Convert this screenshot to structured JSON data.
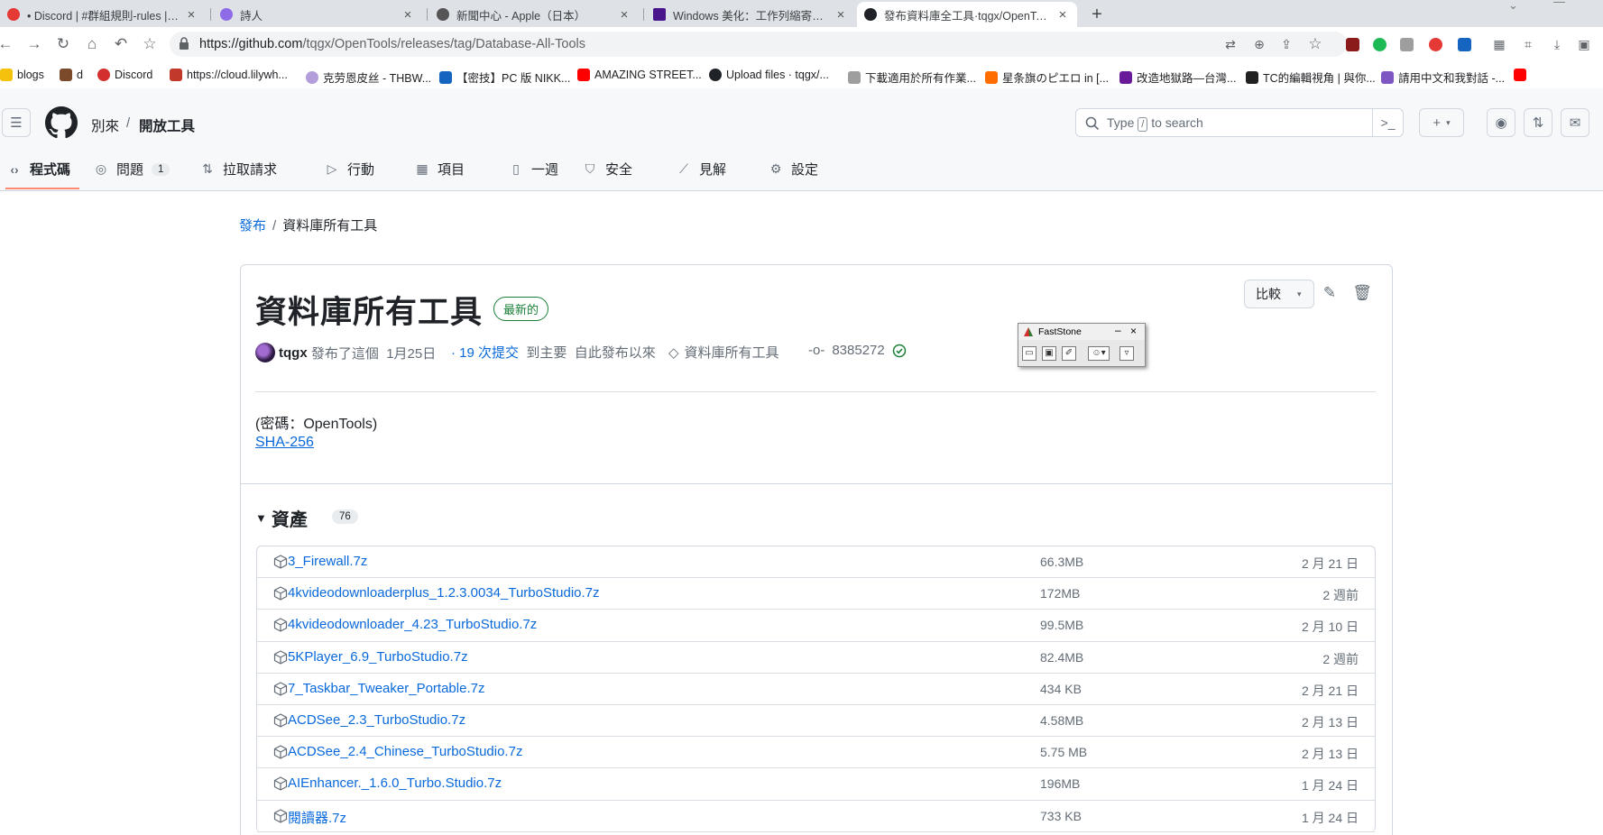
{
  "browser": {
    "tabs": [
      {
        "title": "• Discord | #群組規則-rules | 虛擬...",
        "icon_color": "#e53935",
        "active": false
      },
      {
        "title": "詩人",
        "icon_color": "#8e6ce8",
        "active": false
      },
      {
        "title": "新聞中心 - Apple（日本）",
        "icon_color": "#555555",
        "active": false
      },
      {
        "title": "Windows 美化：工作列縮寄、視...",
        "icon_color": "#4a148c",
        "active": false
      },
      {
        "title": "發布資料庫全工具·tqgx/OpenTools",
        "icon_color": "#1f2328",
        "active": true
      }
    ],
    "new_tab": "+",
    "url_host": "https://github.com",
    "url_path": "/tqgx/OpenTools/releases/tag/Database-All-Tools",
    "bookmarks": [
      {
        "label": "blogs",
        "icon_color": "#f4c20d"
      },
      {
        "label": "d",
        "icon_color": "#7b4a2a"
      },
      {
        "label": "Discord",
        "icon_color": "#d32f2f"
      },
      {
        "label": "https://cloud.lilywh...",
        "icon_color": "#c0392b"
      },
      {
        "label": "克劳恩皮丝 - THBW...",
        "icon_color": "#b39ddb"
      },
      {
        "label": "【密技】PC 版 NIKK...",
        "icon_color": "#1565c0"
      },
      {
        "label": "AMAZING STREET...",
        "icon_color": "#ff0000"
      },
      {
        "label": "Upload files · tqgx/...",
        "icon_color": "#1f2328"
      },
      {
        "label": "下載適用於所有作業...",
        "icon_color": "#9e9e9e"
      },
      {
        "label": "星条旗のピエロ in [...",
        "icon_color": "#ff6d00"
      },
      {
        "label": "改造地獄路—台灣...",
        "icon_color": "#6a1b9a"
      },
      {
        "label": "TC的編輯視角 | 與你...",
        "icon_color": "#212121"
      },
      {
        "label": "請用中文和我對話 -...",
        "icon_color": "#7e57c2"
      },
      {
        "label": "",
        "icon_color": "#ff0000"
      }
    ]
  },
  "github": {
    "owner": "別來",
    "repo": "開放工具",
    "search_prefix": "Type",
    "search_key": "/",
    "search_suffix": "to search",
    "nav": [
      {
        "label": "程式碼",
        "icon": "code-icon",
        "glyph": "‹›"
      },
      {
        "label": "問題",
        "icon": "issue-icon",
        "glyph": "◎",
        "count": "1"
      },
      {
        "label": "拉取請求",
        "icon": "pull-request-icon",
        "glyph": "⇅"
      },
      {
        "label": "行動",
        "icon": "actions-icon",
        "glyph": "▷"
      },
      {
        "label": "項目",
        "icon": "projects-icon",
        "glyph": "▦"
      },
      {
        "label": "一週",
        "icon": "wiki-icon",
        "glyph": "📖"
      },
      {
        "label": "安全",
        "icon": "shield-icon",
        "glyph": "⛉"
      },
      {
        "label": "見解",
        "icon": "graph-icon",
        "glyph": "⟋"
      },
      {
        "label": "設定",
        "icon": "gear-icon",
        "glyph": "⚙"
      }
    ]
  },
  "release": {
    "breadcrumb_link": "發布",
    "breadcrumb_current": "資料庫所有工具",
    "title": "資料庫所有工具",
    "badge": "最新的",
    "compare_label": "比較",
    "author": "tqgx",
    "published_text": "發布了這個",
    "date": "1月25日",
    "commits_link": "· 19 次提交",
    "commits_to": "到主要",
    "since_text": "自此發布以來",
    "tag": "資料庫所有工具",
    "commit": "8385272",
    "password_line": "(密碼：OpenTools)",
    "sha_link": "SHA-256"
  },
  "assets": {
    "heading": "資產",
    "count": "76",
    "items": [
      {
        "name": "3_Firewall.7z",
        "size": "66.3MB",
        "date": "2 月 21 日"
      },
      {
        "name": "4kvideodownloaderplus_1.2.3.0034_TurboStudio.7z",
        "size": "172MB",
        "date": "2 週前"
      },
      {
        "name": "4kvideodownloader_4.23_TurboStudio.7z",
        "size": "99.5MB",
        "date": "2 月 10 日"
      },
      {
        "name": "5KPlayer_6.9_TurboStudio.7z",
        "size": "82.4MB",
        "date": "2 週前"
      },
      {
        "name": "7_Taskbar_Tweaker_Portable.7z",
        "size": "434 KB",
        "date": "2 月 21 日"
      },
      {
        "name": "ACDSee_2.3_TurboStudio.7z",
        "size": "4.58MB",
        "date": "2 月 13 日"
      },
      {
        "name": "ACDSee_2.4_Chinese_TurboStudio.7z",
        "size": "5.75 MB",
        "date": "2 月 13 日"
      },
      {
        "name": "AIEnhancer._1.6.0_Turbo.Studio.7z",
        "size": "196MB",
        "date": "1 月 24 日"
      },
      {
        "name": "閱讀器.7z",
        "size": "733 KB",
        "date": "1 月 24 日"
      }
    ]
  },
  "faststone": {
    "title": "FastStone"
  },
  "colors": {
    "link": "#0969da",
    "latest_green": "#1a7f37",
    "nav_underline": "#fd8c73"
  }
}
